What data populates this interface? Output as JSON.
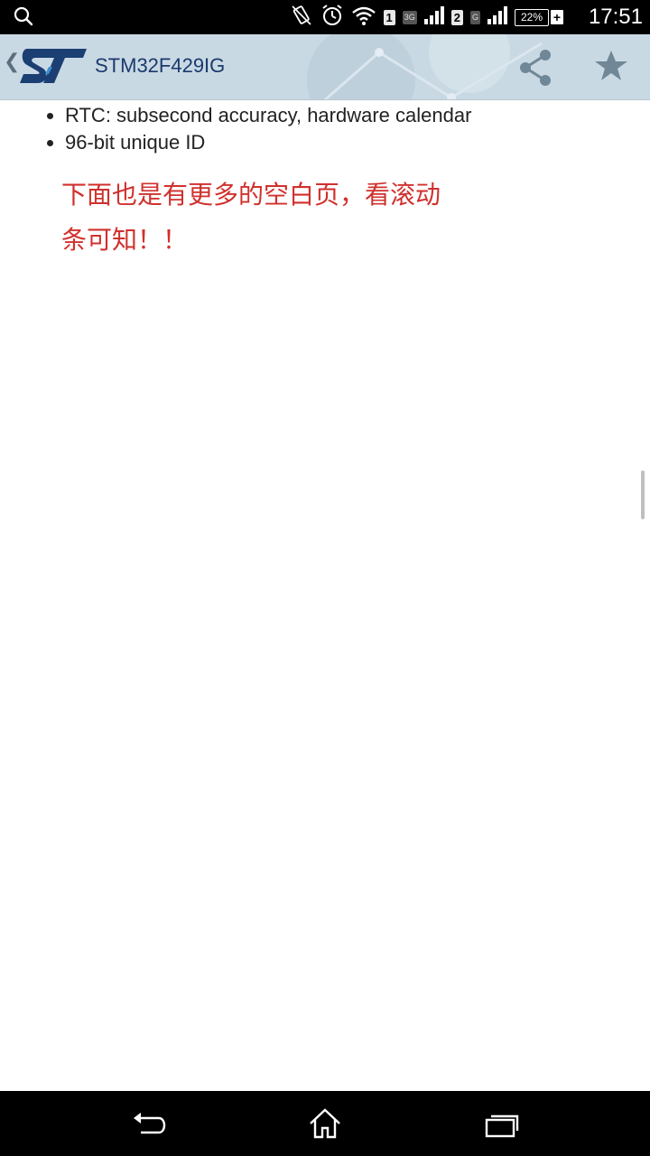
{
  "status_bar": {
    "time": "17:51",
    "battery_percent": "22%",
    "sim1_label": "1",
    "sim1_network": "3G",
    "sim2_label": "2",
    "sim2_network": "G",
    "icons": [
      "search-icon",
      "vibrate-icon",
      "alarm-icon",
      "wifi-icon",
      "signal-icon",
      "battery-icon"
    ]
  },
  "app_bar": {
    "title": "STM32F429IG",
    "logo_icon": "st-logo",
    "actions": [
      "share-icon",
      "star-icon"
    ],
    "background_color": "#c9d9e4",
    "title_color": "#1a3a6c"
  },
  "content": {
    "bullets": [
      "RTC: subsecond accuracy, hardware calendar",
      "96-bit unique ID"
    ],
    "note_line1": "下面也是有更多的空白页，看滚动",
    "note_line2": "条可知！！",
    "note_color": "#d0312d"
  },
  "nav_bar": {
    "buttons": [
      "back-icon",
      "home-icon",
      "recent-apps-icon"
    ]
  }
}
